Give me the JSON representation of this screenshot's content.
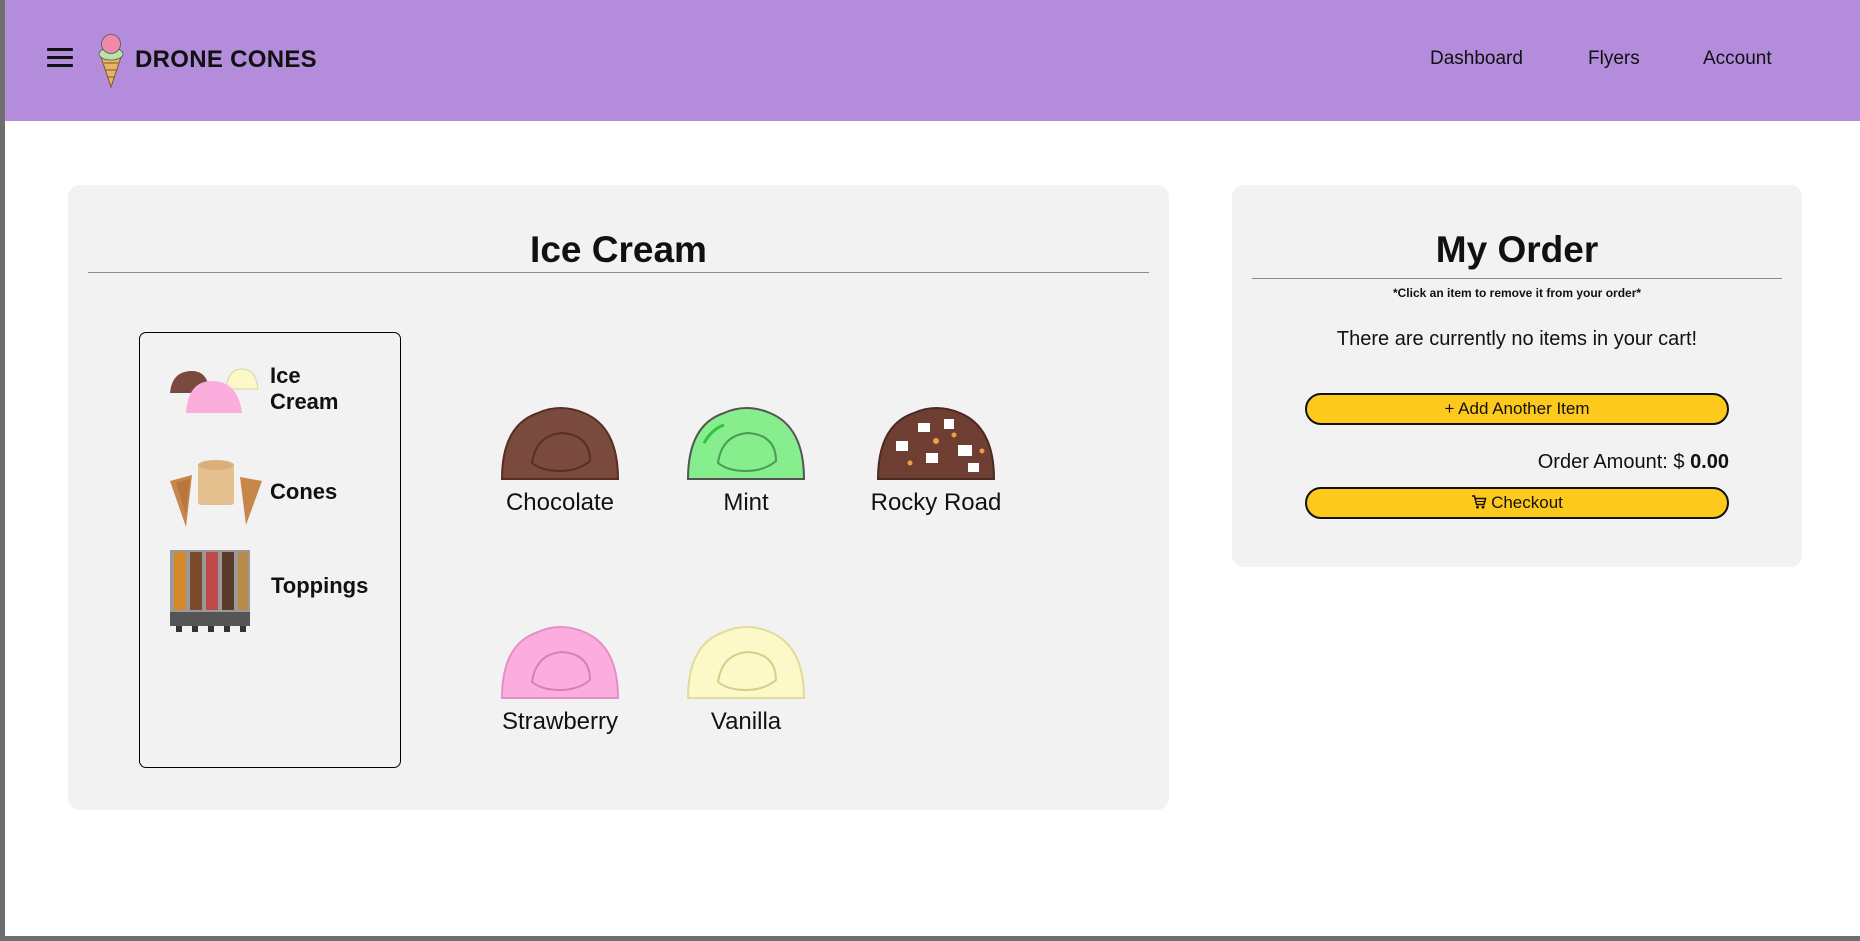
{
  "header": {
    "brand": "DRONE CONES",
    "nav": {
      "dashboard": "Dashboard",
      "flyers": "Flyers",
      "account": "Account"
    },
    "bg_color": "#b38cdb"
  },
  "menu": {
    "title": "Ice Cream",
    "categories": [
      {
        "label": "Ice Cream",
        "icon": "ice-cream-scoops-icon"
      },
      {
        "label": "Cones",
        "icon": "cones-icon"
      },
      {
        "label": "Toppings",
        "icon": "toppings-dispenser-icon"
      }
    ],
    "flavors": [
      {
        "name": "Chocolate",
        "color": "#7a4a3e"
      },
      {
        "name": "Mint",
        "color": "#86ee8c"
      },
      {
        "name": "Rocky Road",
        "color": "#6e3e33"
      },
      {
        "name": "Strawberry",
        "color": "#fbaede"
      },
      {
        "name": "Vanilla",
        "color": "#fcf8c8"
      }
    ]
  },
  "order": {
    "title": "My Order",
    "hint": "*Click an item to remove it from your order*",
    "empty_message": "There are currently no items in your cart!",
    "add_button": "+ Add Another Item",
    "amount_label": "Order Amount: $",
    "amount_value": "0.00",
    "checkout_button": "Checkout",
    "button_color": "#fdc91d"
  }
}
